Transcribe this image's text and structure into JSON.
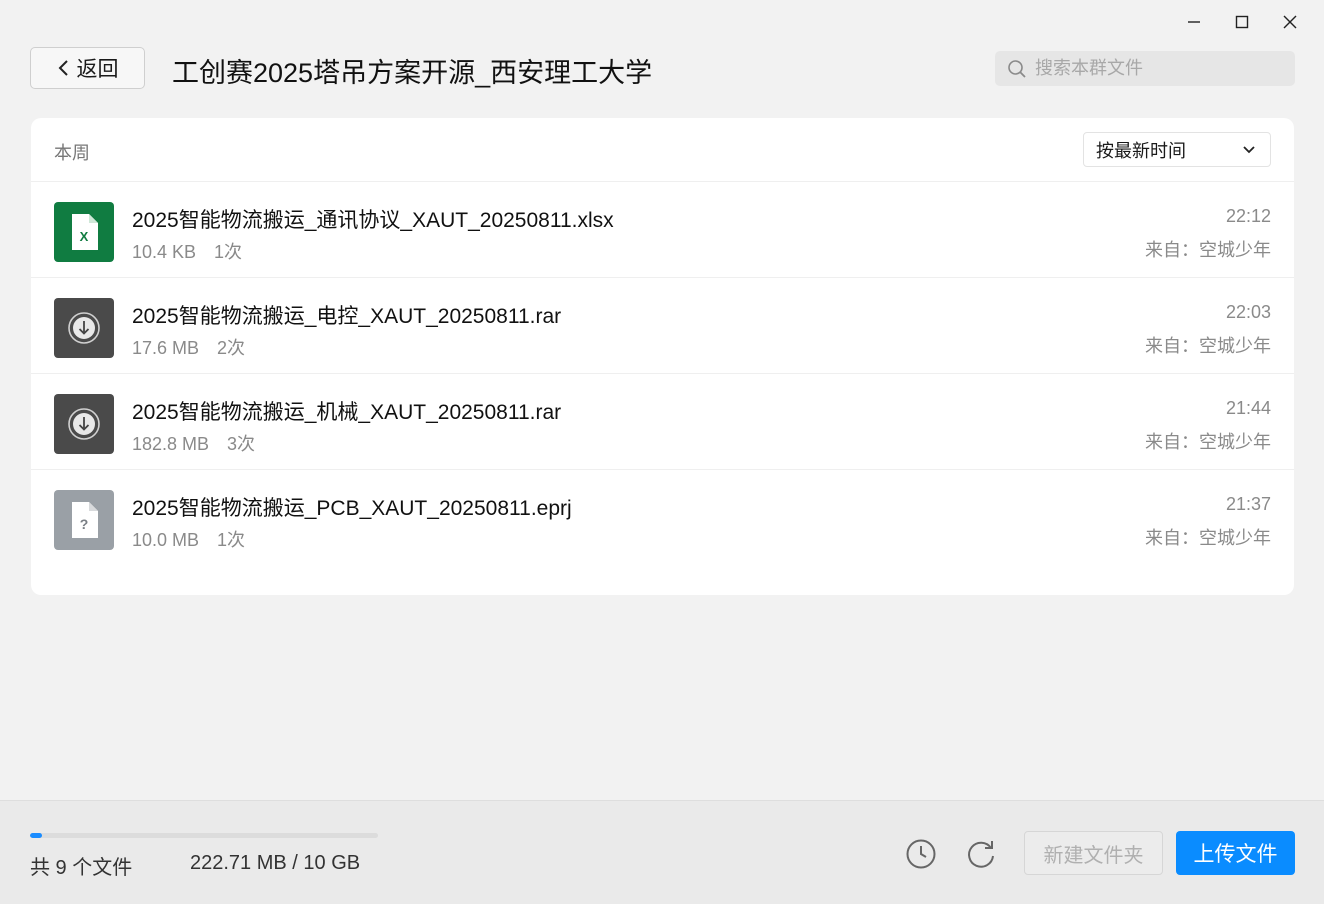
{
  "window": {
    "minimize_icon": "minimize-icon",
    "maximize_icon": "maximize-icon",
    "close_icon": "close-icon"
  },
  "header": {
    "back_label": "返回",
    "title": "工创赛2025塔吊方案开源_西安理工大学",
    "search_placeholder": "搜索本群文件"
  },
  "panel": {
    "section_label": "本周",
    "sort_label": "按最新时间",
    "files": [
      {
        "name": "2025智能物流搬运_通讯协议_XAUT_20250811.xlsx",
        "size": "10.4 KB",
        "downloads": "1次",
        "time": "22:12",
        "from": "来自：空城少年",
        "type": "excel",
        "color": "#107c41"
      },
      {
        "name": "2025智能物流搬运_电控_XAUT_20250811.rar",
        "size": "17.6 MB",
        "downloads": "2次",
        "time": "22:03",
        "from": "来自：空城少年",
        "type": "archive",
        "color": "#4a4a4a"
      },
      {
        "name": "2025智能物流搬运_机械_XAUT_20250811.rar",
        "size": "182.8 MB",
        "downloads": "3次",
        "time": "21:44",
        "from": "来自：空城少年",
        "type": "archive",
        "color": "#4a4a4a"
      },
      {
        "name": "2025智能物流搬运_PCB_XAUT_20250811.eprj",
        "size": "10.0 MB",
        "downloads": "1次",
        "time": "21:37",
        "from": "来自：空城少年",
        "type": "unknown",
        "color": "#9aa0a6"
      }
    ]
  },
  "footer": {
    "file_count": "共 9 个文件",
    "storage": "222.71 MB / 10 GB",
    "storage_fraction": 0.0217,
    "new_folder_label": "新建文件夹",
    "upload_label": "上传文件",
    "accent": "#0a8cff"
  }
}
